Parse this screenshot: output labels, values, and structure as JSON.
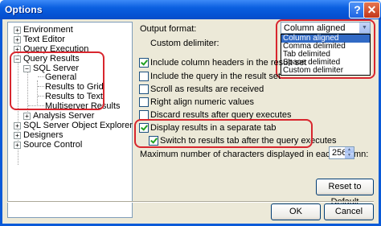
{
  "window": {
    "title": "Options",
    "help_glyph": "?",
    "close_glyph": "✕"
  },
  "tree": {
    "items": [
      {
        "label": "Environment",
        "expander": "+"
      },
      {
        "label": "Text Editor",
        "expander": "+"
      },
      {
        "label": "Query Execution",
        "expander": "+"
      },
      {
        "label": "Query Results",
        "expander": "−"
      },
      {
        "label": "SQL Server",
        "expander": "−"
      },
      {
        "label": "General"
      },
      {
        "label": "Results to Grid"
      },
      {
        "label": "Results to Text"
      },
      {
        "label": "Multiserver Results"
      },
      {
        "label": "Analysis Server",
        "expander": "+"
      },
      {
        "label": "SQL Server Object Explorer",
        "expander": "+"
      },
      {
        "label": "Designers",
        "expander": "+"
      },
      {
        "label": "Source Control",
        "expander": "+"
      }
    ]
  },
  "settings": {
    "output_format_label": "Output format:",
    "custom_delimiter_label": "Custom delimiter:",
    "output_format_value": "Column aligned",
    "output_format_options": [
      "Column aligned",
      "Comma delimited",
      "Tab delimited",
      "Space delimited",
      "Custom delimiter"
    ],
    "checkboxes": [
      {
        "label": "Include column headers in the result set",
        "checked": true
      },
      {
        "label": "Include the query in the result set",
        "checked": false
      },
      {
        "label": "Scroll as results are received",
        "checked": false
      },
      {
        "label": "Right align numeric values",
        "checked": false
      },
      {
        "label": "Discard results after query executes",
        "checked": false
      },
      {
        "label": "Display results in a separate tab",
        "checked": true
      },
      {
        "label": "Switch to results tab after the query executes",
        "checked": true
      }
    ],
    "max_chars_label": "Maximum number of characters displayed in each column:",
    "max_chars_value": "256",
    "reset_label": "Reset to Default"
  },
  "footer": {
    "ok_label": "OK",
    "cancel_label": "Cancel"
  },
  "colors": {
    "title_bar": "#0552d3",
    "highlight_box": "#d8262e",
    "selection": "#316ac5"
  }
}
